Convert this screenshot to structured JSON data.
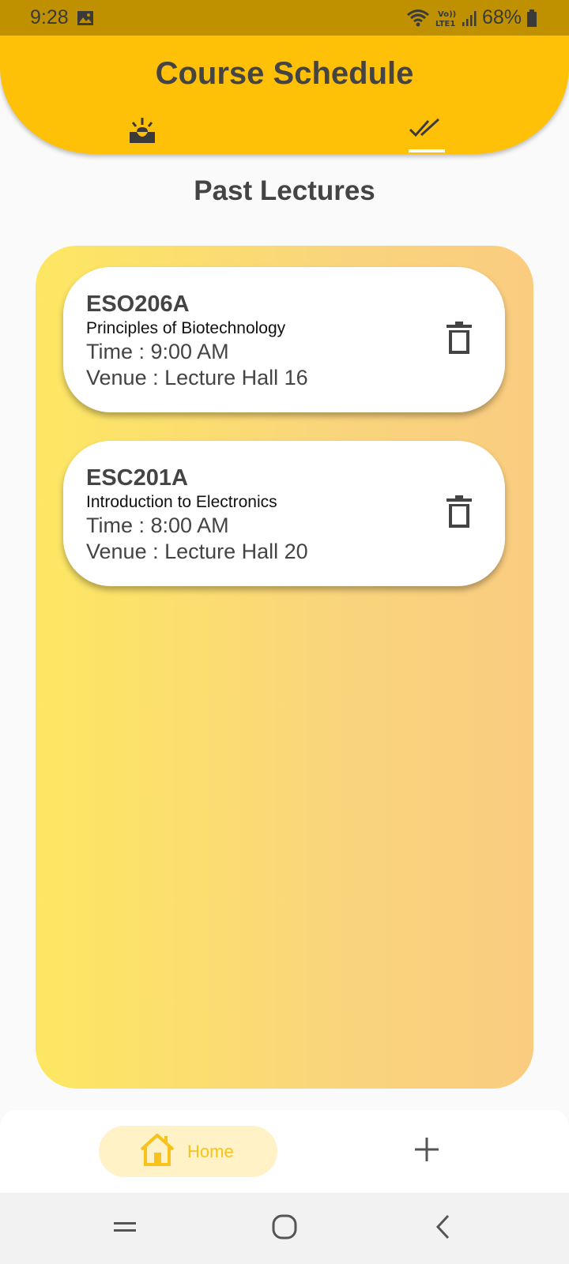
{
  "status_bar": {
    "time": "9:28",
    "battery": "68%",
    "icons": [
      "gallery-icon",
      "wifi-icon",
      "volte-icon",
      "signal-icon",
      "battery-icon"
    ]
  },
  "header": {
    "title": "Course Schedule",
    "tabs": [
      {
        "name": "upcoming",
        "icon": "alarm-light-icon",
        "selected": false
      },
      {
        "name": "past",
        "icon": "double-check-icon",
        "selected": true
      }
    ]
  },
  "section": {
    "title": "Past Lectures"
  },
  "lectures": [
    {
      "code": "ESO206A",
      "name": "Principles of Biotechnology",
      "time": "Time : 9:00 AM",
      "venue": "Venue : Lecture Hall 16"
    },
    {
      "code": "ESC201A",
      "name": "Introduction to Electronics",
      "time": "Time : 8:00 AM",
      "venue": "Venue : Lecture Hall 20"
    }
  ],
  "bottom_nav": {
    "home_label": "Home",
    "home_icon": "house-icon",
    "add_icon": "plus-icon"
  },
  "colors": {
    "status_bar": "#bf9000",
    "header": "#ffc107",
    "accent": "#f7c21a",
    "text": "#444444"
  }
}
